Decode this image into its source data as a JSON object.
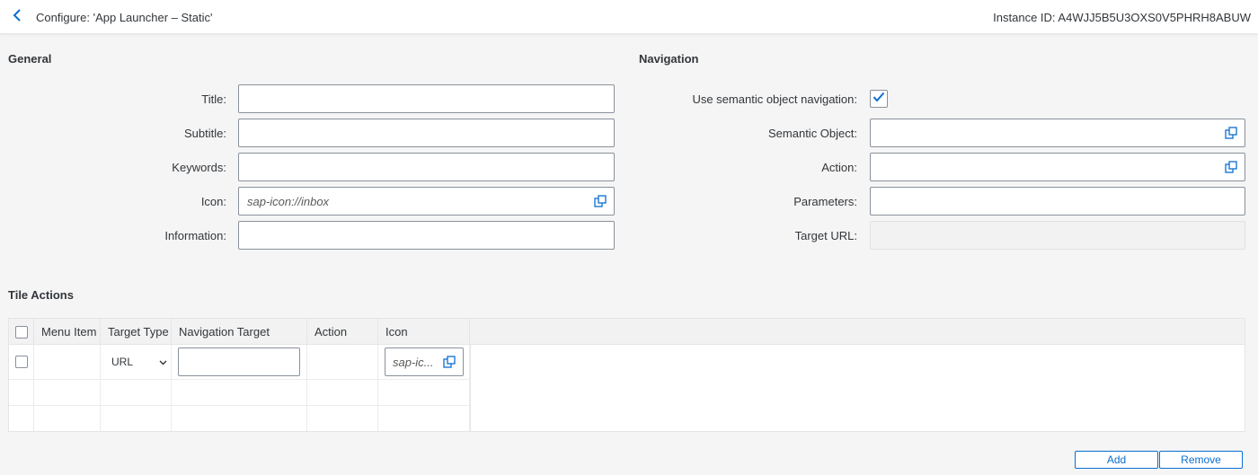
{
  "header": {
    "title": "Configure: 'App Launcher – Static'",
    "instance_id": "Instance ID: A4WJJ5B5U3OXS0V5PHRH8ABUW"
  },
  "general": {
    "section_title": "General",
    "fields": {
      "title": {
        "label": "Title:",
        "value": ""
      },
      "subtitle": {
        "label": "Subtitle:",
        "value": ""
      },
      "keywords": {
        "label": "Keywords:",
        "value": ""
      },
      "icon": {
        "label": "Icon:",
        "placeholder": "sap-icon://inbox"
      },
      "information": {
        "label": "Information:",
        "value": ""
      }
    }
  },
  "navigation": {
    "section_title": "Navigation",
    "use_semantic": {
      "label": "Use semantic object navigation:",
      "checked": true
    },
    "semantic_object": {
      "label": "Semantic Object:",
      "value": ""
    },
    "action": {
      "label": "Action:",
      "value": ""
    },
    "parameters": {
      "label": "Parameters:",
      "value": ""
    },
    "target_url": {
      "label": "Target URL:",
      "value": ""
    }
  },
  "tile_actions": {
    "section_title": "Tile Actions",
    "columns": [
      "Menu Item",
      "Target Type",
      "Navigation Target",
      "Action",
      "Icon"
    ],
    "row": {
      "target_type": "URL",
      "icon_placeholder": "sap-ic..."
    }
  },
  "buttons": {
    "add": "Add",
    "remove": "Remove"
  },
  "colors": {
    "accent": "#0a6ed1",
    "background": "#f5f5f5",
    "text": "#32363a"
  }
}
